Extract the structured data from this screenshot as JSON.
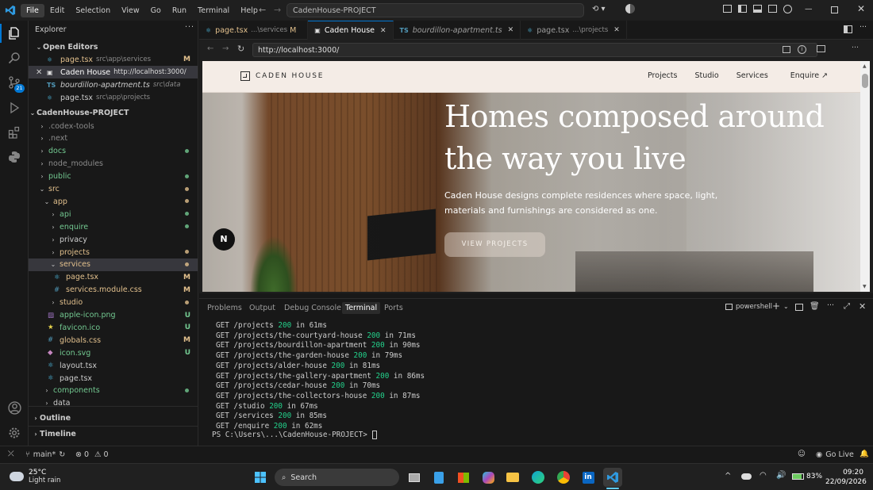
{
  "titlebar": {
    "menu": [
      "File",
      "Edit",
      "Selection",
      "View",
      "Go",
      "Run",
      "Terminal",
      "Help"
    ],
    "search_text": "CadenHouse-PROJECT"
  },
  "sidebar": {
    "title": "Explorer",
    "open_editors_header": "Open Editors",
    "open_editors": [
      {
        "name": "page.tsx",
        "path": "src\\app\\services",
        "badge": "M"
      },
      {
        "name": "Caden House",
        "path": "http://localhost:3000/",
        "badge": ""
      },
      {
        "name": "bourdillon-apartment.ts",
        "path": "src\\data",
        "badge": ""
      },
      {
        "name": "page.tsx",
        "path": "src\\app\\projects",
        "badge": ""
      }
    ],
    "project_header": "CadenHouse-PROJECT",
    "tree": [
      {
        "name": ".codex-tools"
      },
      {
        "name": ".next"
      },
      {
        "name": "docs"
      },
      {
        "name": "node_modules"
      },
      {
        "name": "public"
      },
      {
        "name": "src"
      },
      {
        "name": "app"
      },
      {
        "name": "api"
      },
      {
        "name": "enquire"
      },
      {
        "name": "privacy"
      },
      {
        "name": "projects"
      },
      {
        "name": "services"
      },
      {
        "name": "page.tsx",
        "badge": "M"
      },
      {
        "name": "services.module.css",
        "badge": "M"
      },
      {
        "name": "studio"
      },
      {
        "name": "apple-icon.png",
        "badge": "U"
      },
      {
        "name": "favicon.ico",
        "badge": "U"
      },
      {
        "name": "globals.css",
        "badge": "M"
      },
      {
        "name": "icon.svg",
        "badge": "U"
      },
      {
        "name": "layout.tsx"
      },
      {
        "name": "page.tsx"
      },
      {
        "name": "components"
      },
      {
        "name": "data"
      }
    ],
    "outline": "Outline",
    "timeline": "Timeline"
  },
  "tabs": [
    {
      "name": "page.tsx",
      "path": "...\\services",
      "badge": "M"
    },
    {
      "name": "Caden House",
      "path": "",
      "badge": ""
    },
    {
      "name": "bourdillon-apartment.ts",
      "path": "",
      "badge": ""
    },
    {
      "name": "page.tsx",
      "path": "...\\projects",
      "badge": ""
    }
  ],
  "browser": {
    "url": "http://localhost:3000/"
  },
  "site": {
    "logo": "CADEN HOUSE",
    "nav": [
      "Projects",
      "Studio",
      "Services",
      "Enquire ↗"
    ],
    "hero_title_1": "Homes composed around",
    "hero_title_2": "the way you live",
    "hero_text_1": "Caden House designs complete residences where space, light,",
    "hero_text_2": "materials and furnishings are considered as one.",
    "cta": "VIEW PROJECTS",
    "next_badge": "N"
  },
  "panel": {
    "tabs": [
      "Problems",
      "Output",
      "Debug Console",
      "Terminal",
      "Ports"
    ],
    "shell": "powershell",
    "lines": [
      {
        "route": "GET /projects",
        "code": "200",
        "time": "in 61ms"
      },
      {
        "route": "GET /projects/the-courtyard-house",
        "code": "200",
        "time": "in 71ms"
      },
      {
        "route": "GET /projects/bourdillon-apartment",
        "code": "200",
        "time": "in 90ms"
      },
      {
        "route": "GET /projects/the-garden-house",
        "code": "200",
        "time": "in 79ms"
      },
      {
        "route": "GET /projects/alder-house",
        "code": "200",
        "time": "in 81ms"
      },
      {
        "route": "GET /projects/the-gallery-apartment",
        "code": "200",
        "time": "in 86ms"
      },
      {
        "route": "GET /projects/cedar-house",
        "code": "200",
        "time": "in 70ms"
      },
      {
        "route": "GET /projects/the-collectors-house",
        "code": "200",
        "time": "in 87ms"
      },
      {
        "route": "GET /studio",
        "code": "200",
        "time": "in 67ms"
      },
      {
        "route": "GET /services",
        "code": "200",
        "time": "in 85ms"
      },
      {
        "route": "GET /enquire",
        "code": "200",
        "time": "in 62ms"
      }
    ],
    "prompt": "PS C:\\Users\\...\\CadenHouse-PROJECT>"
  },
  "statusbar": {
    "branch": "main*",
    "errors": "0",
    "warnings": "0",
    "golive": "Go Live"
  },
  "taskbar": {
    "temp": "25°C",
    "weather": "Light rain",
    "search": "Search",
    "battery": "83%",
    "time": "09:20",
    "date": "22/09/2026"
  },
  "colors": {
    "accent": "#0078d4",
    "modified": "#e2c08d",
    "untracked": "#73c991",
    "folder_green": "#73c991"
  }
}
